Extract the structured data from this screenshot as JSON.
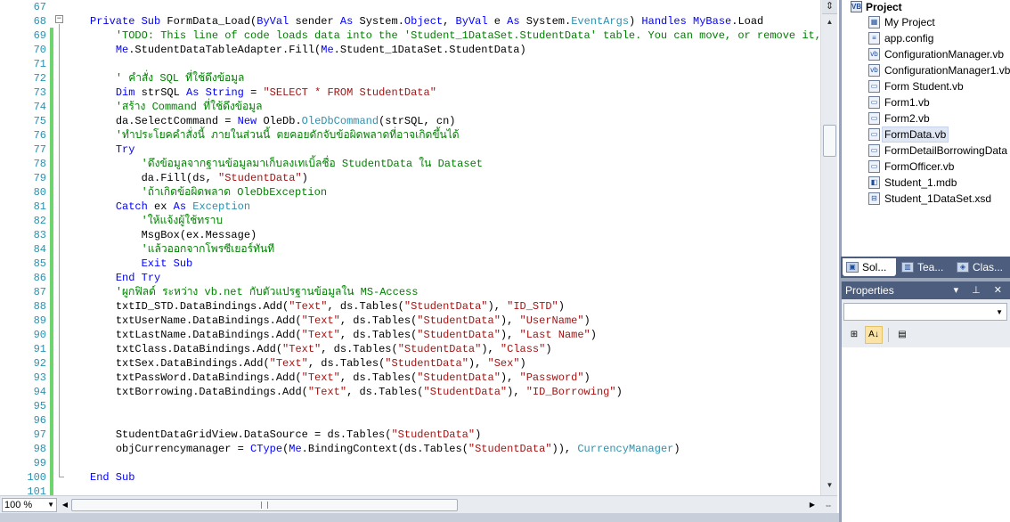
{
  "editor": {
    "line_numbers": [
      "67",
      "68",
      "69",
      "70",
      "71",
      "72",
      "73",
      "74",
      "75",
      "76",
      "77",
      "78",
      "79",
      "80",
      "81",
      "82",
      "83",
      "84",
      "85",
      "86",
      "87",
      "88",
      "89",
      "90",
      "91",
      "92",
      "93",
      "94",
      "95",
      "96",
      "97",
      "98",
      "99",
      "100",
      "101"
    ],
    "lines": [
      [],
      [
        [
          "kw",
          "Private Sub "
        ],
        [
          "",
          "FormData_Load("
        ],
        [
          "kw",
          "ByVal "
        ],
        [
          "",
          "sender "
        ],
        [
          "kw",
          "As "
        ],
        [
          "",
          "System."
        ],
        [
          "kw",
          "Object"
        ],
        [
          "",
          ", "
        ],
        [
          "kw",
          "ByVal "
        ],
        [
          "",
          "e "
        ],
        [
          "kw",
          "As "
        ],
        [
          "",
          "System."
        ],
        [
          "ty",
          "EventArgs"
        ],
        [
          "",
          ") "
        ],
        [
          "kw",
          "Handles "
        ],
        [
          "kw",
          "MyBase"
        ],
        [
          "",
          ".Load"
        ]
      ],
      [
        [
          "",
          "    "
        ],
        [
          "cm",
          "'TODO: This line of code loads data into the 'Student_1DataSet.StudentData' table. You can move, or remove it, as"
        ]
      ],
      [
        [
          "",
          "    "
        ],
        [
          "kw",
          "Me"
        ],
        [
          "",
          ".StudentDataTableAdapter.Fill("
        ],
        [
          "kw",
          "Me"
        ],
        [
          "",
          ".Student_1DataSet.StudentData)"
        ]
      ],
      [],
      [
        [
          "",
          "    "
        ],
        [
          "cm",
          "' คำสั่ง SQL ที่ใช้ดึงข้อมูล"
        ]
      ],
      [
        [
          "",
          "    "
        ],
        [
          "kw",
          "Dim "
        ],
        [
          "",
          "strSQL "
        ],
        [
          "kw",
          "As String "
        ],
        [
          "",
          "= "
        ],
        [
          "st",
          "\"SELECT * FROM StudentData\""
        ]
      ],
      [
        [
          "",
          "    "
        ],
        [
          "cm",
          "'สร้าง Command ที่ใช้ดึงข้อมูล"
        ]
      ],
      [
        [
          "",
          "    "
        ],
        [
          "",
          "da.SelectCommand = "
        ],
        [
          "kw",
          "New "
        ],
        [
          "",
          "OleDb."
        ],
        [
          "ty",
          "OleDbCommand"
        ],
        [
          "",
          "(strSQL, cn)"
        ]
      ],
      [
        [
          "",
          "    "
        ],
        [
          "cm",
          "'ทำประโยคคำสั่งนี้ ภายในส่วนนี้ ตยคอยดักจับข้อผิดพลาดที่อาจเกิดขึ้นได้"
        ]
      ],
      [
        [
          "",
          "    "
        ],
        [
          "kw",
          "Try"
        ]
      ],
      [
        [
          "",
          "        "
        ],
        [
          "cm",
          "'ดึงข้อมูลจากฐานข้อมูลมาเก็บลงเทเบิ้ลชื่อ StudentData ใน Dataset"
        ]
      ],
      [
        [
          "",
          "        "
        ],
        [
          "",
          "da.Fill(ds, "
        ],
        [
          "st",
          "\"StudentData\""
        ],
        [
          "",
          ")"
        ]
      ],
      [
        [
          "",
          "        "
        ],
        [
          "cm",
          "'ถ้าเกิดข้อผิดพลาด OleDbException"
        ]
      ],
      [
        [
          "",
          "    "
        ],
        [
          "kw",
          "Catch "
        ],
        [
          "",
          "ex "
        ],
        [
          "kw",
          "As "
        ],
        [
          "ty",
          "Exception"
        ]
      ],
      [
        [
          "",
          "        "
        ],
        [
          "cm",
          "'ให้แจ้งผู้ใช้ทราบ"
        ]
      ],
      [
        [
          "",
          "        "
        ],
        [
          "",
          "MsgBox(ex.Message)"
        ]
      ],
      [
        [
          "",
          "        "
        ],
        [
          "cm",
          "'แล้วออกจากโพรซีเยอร์ทันที"
        ]
      ],
      [
        [
          "",
          "        "
        ],
        [
          "kw",
          "Exit Sub"
        ]
      ],
      [
        [
          "",
          "    "
        ],
        [
          "kw",
          "End Try"
        ]
      ],
      [
        [
          "",
          "    "
        ],
        [
          "cm",
          "'ผูกฟิลด์ ระหว่าง vb.net กับตัวแปรฐานข้อมูลใน MS-Access"
        ]
      ],
      [
        [
          "",
          "    "
        ],
        [
          "",
          "txtID_STD.DataBindings.Add("
        ],
        [
          "st",
          "\"Text\""
        ],
        [
          "",
          ", ds.Tables("
        ],
        [
          "st",
          "\"StudentData\""
        ],
        [
          "",
          "), "
        ],
        [
          "st",
          "\"ID_STD\""
        ],
        [
          "",
          ")"
        ]
      ],
      [
        [
          "",
          "    "
        ],
        [
          "",
          "txtUserName.DataBindings.Add("
        ],
        [
          "st",
          "\"Text\""
        ],
        [
          "",
          ", ds.Tables("
        ],
        [
          "st",
          "\"StudentData\""
        ],
        [
          "",
          "), "
        ],
        [
          "st",
          "\"UserName\""
        ],
        [
          "",
          ")"
        ]
      ],
      [
        [
          "",
          "    "
        ],
        [
          "",
          "txtLastName.DataBindings.Add("
        ],
        [
          "st",
          "\"Text\""
        ],
        [
          "",
          ", ds.Tables("
        ],
        [
          "st",
          "\"StudentData\""
        ],
        [
          "",
          "), "
        ],
        [
          "st",
          "\"Last Name\""
        ],
        [
          "",
          ")"
        ]
      ],
      [
        [
          "",
          "    "
        ],
        [
          "",
          "txtClass.DataBindings.Add("
        ],
        [
          "st",
          "\"Text\""
        ],
        [
          "",
          ", ds.Tables("
        ],
        [
          "st",
          "\"StudentData\""
        ],
        [
          "",
          "), "
        ],
        [
          "st",
          "\"Class\""
        ],
        [
          "",
          ")"
        ]
      ],
      [
        [
          "",
          "    "
        ],
        [
          "",
          "txtSex.DataBindings.Add("
        ],
        [
          "st",
          "\"Text\""
        ],
        [
          "",
          ", ds.Tables("
        ],
        [
          "st",
          "\"StudentData\""
        ],
        [
          "",
          "), "
        ],
        [
          "st",
          "\"Sex\""
        ],
        [
          "",
          ")"
        ]
      ],
      [
        [
          "",
          "    "
        ],
        [
          "",
          "txtPassWord.DataBindings.Add("
        ],
        [
          "st",
          "\"Text\""
        ],
        [
          "",
          ", ds.Tables("
        ],
        [
          "st",
          "\"StudentData\""
        ],
        [
          "",
          "), "
        ],
        [
          "st",
          "\"Password\""
        ],
        [
          "",
          ")"
        ]
      ],
      [
        [
          "",
          "    "
        ],
        [
          "",
          "txtBorrowing.DataBindings.Add("
        ],
        [
          "st",
          "\"Text\""
        ],
        [
          "",
          ", ds.Tables("
        ],
        [
          "st",
          "\"StudentData\""
        ],
        [
          "",
          "), "
        ],
        [
          "st",
          "\"ID_Borrowing\""
        ],
        [
          "",
          ")"
        ]
      ],
      [],
      [],
      [
        [
          "",
          "    "
        ],
        [
          "",
          "StudentDataGridView.DataSource = ds.Tables("
        ],
        [
          "st",
          "\"StudentData\""
        ],
        [
          "",
          ")"
        ]
      ],
      [
        [
          "",
          "    "
        ],
        [
          "",
          "objCurrencymanager = "
        ],
        [
          "kw",
          "CType"
        ],
        [
          "",
          "("
        ],
        [
          "kw",
          "Me"
        ],
        [
          "",
          ".BindingContext(ds.Tables("
        ],
        [
          "st",
          "\"StudentData\""
        ],
        [
          "",
          ")), "
        ],
        [
          "ty",
          "CurrencyManager"
        ],
        [
          "",
          ")"
        ]
      ],
      [],
      [
        [
          "kw",
          "End Sub"
        ]
      ],
      []
    ],
    "zoom": "100 %"
  },
  "solution_explorer": {
    "project": "Project",
    "items": [
      {
        "label": "My Project",
        "icon": "my-project-icon"
      },
      {
        "label": "app.config",
        "icon": "config-file-icon"
      },
      {
        "label": "ConfigurationManager.vb",
        "icon": "vb-file-icon"
      },
      {
        "label": "ConfigurationManager1.vb",
        "icon": "vb-file-icon"
      },
      {
        "label": "Form Student.vb",
        "icon": "form-file-icon"
      },
      {
        "label": "Form1.vb",
        "icon": "form-file-icon"
      },
      {
        "label": "Form2.vb",
        "icon": "form-file-icon"
      },
      {
        "label": "FormData.vb",
        "icon": "form-file-icon",
        "selected": true
      },
      {
        "label": "FormDetailBorrowingData",
        "icon": "form-file-icon"
      },
      {
        "label": "FormOfficer.vb",
        "icon": "form-file-icon"
      },
      {
        "label": "Student_1.mdb",
        "icon": "database-file-icon"
      },
      {
        "label": "Student_1DataSet.xsd",
        "icon": "dataset-file-icon"
      }
    ]
  },
  "panel_tabs": [
    {
      "label": "Sol...",
      "icon": "solution-explorer-icon",
      "active": true
    },
    {
      "label": "Tea...",
      "icon": "team-explorer-icon"
    },
    {
      "label": "Clas...",
      "icon": "class-view-icon"
    }
  ],
  "properties": {
    "title": "Properties",
    "buttons": "▾ ⊥ ✕"
  }
}
